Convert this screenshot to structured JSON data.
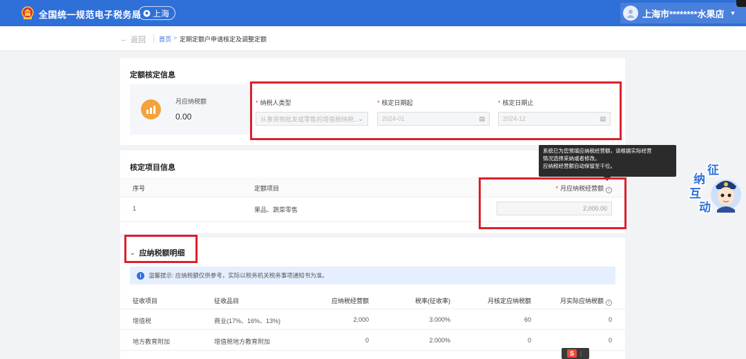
{
  "header": {
    "site_title": "全国统一规范电子税务局",
    "location": "上海",
    "user_name": "上海市********水果店",
    "brand_color": "#2f6fd8"
  },
  "breadcrumb": {
    "back_label": "返回",
    "home": "首页",
    "separator": ">",
    "current": "定期定额户申请核定及调整定额"
  },
  "quota_info": {
    "title": "定额核定信息",
    "stat_label": "月应纳税额",
    "stat_value": "0.00",
    "taxpayer_type_label": "纳税人类型",
    "taxpayer_type_value": "从事货物批发或零售的增值税纳税...",
    "start_date_label": "核定日期起",
    "start_date_value": "2024-01",
    "end_date_label": "核定日期止",
    "end_date_value": "2024-12"
  },
  "items_info": {
    "title": "核定项目信息",
    "headers": [
      "序号",
      "定额项目",
      "月应纳税经营额"
    ],
    "rows": [
      {
        "index": "1",
        "item": "果品、蔬菜零售",
        "amount": "2,000.00"
      }
    ]
  },
  "tooltip": {
    "line1": "系统已为您预填应纳税经营额，请根据实际经营",
    "line2": "情况选择采纳或者修改。",
    "line3": "应纳税经营额自动保留至千位。"
  },
  "tax_detail": {
    "title": "应纳税额明细",
    "notice": "温馨提示: 应纳税额仅供参考，实际以税务机关税务事项通知书为准。",
    "headers": [
      "征收项目",
      "征收品目",
      "应纳税经营额",
      "税率(征收率)",
      "月核定应纳税额",
      "月实际应纳税额"
    ],
    "rows": [
      [
        "增值税",
        "商业(17%、16%、13%)",
        "2,000",
        "3.000%",
        "60",
        "0"
      ],
      [
        "地方教育附加",
        "增值税地方教育附加",
        "0",
        "2.000%",
        "0",
        "0"
      ]
    ]
  },
  "helper": {
    "chars": [
      "征",
      "纳",
      "互",
      "动"
    ]
  },
  "colors": {
    "highlight": "#d9202a",
    "required": "#e33333",
    "stat_icon": "#f5a23a"
  }
}
